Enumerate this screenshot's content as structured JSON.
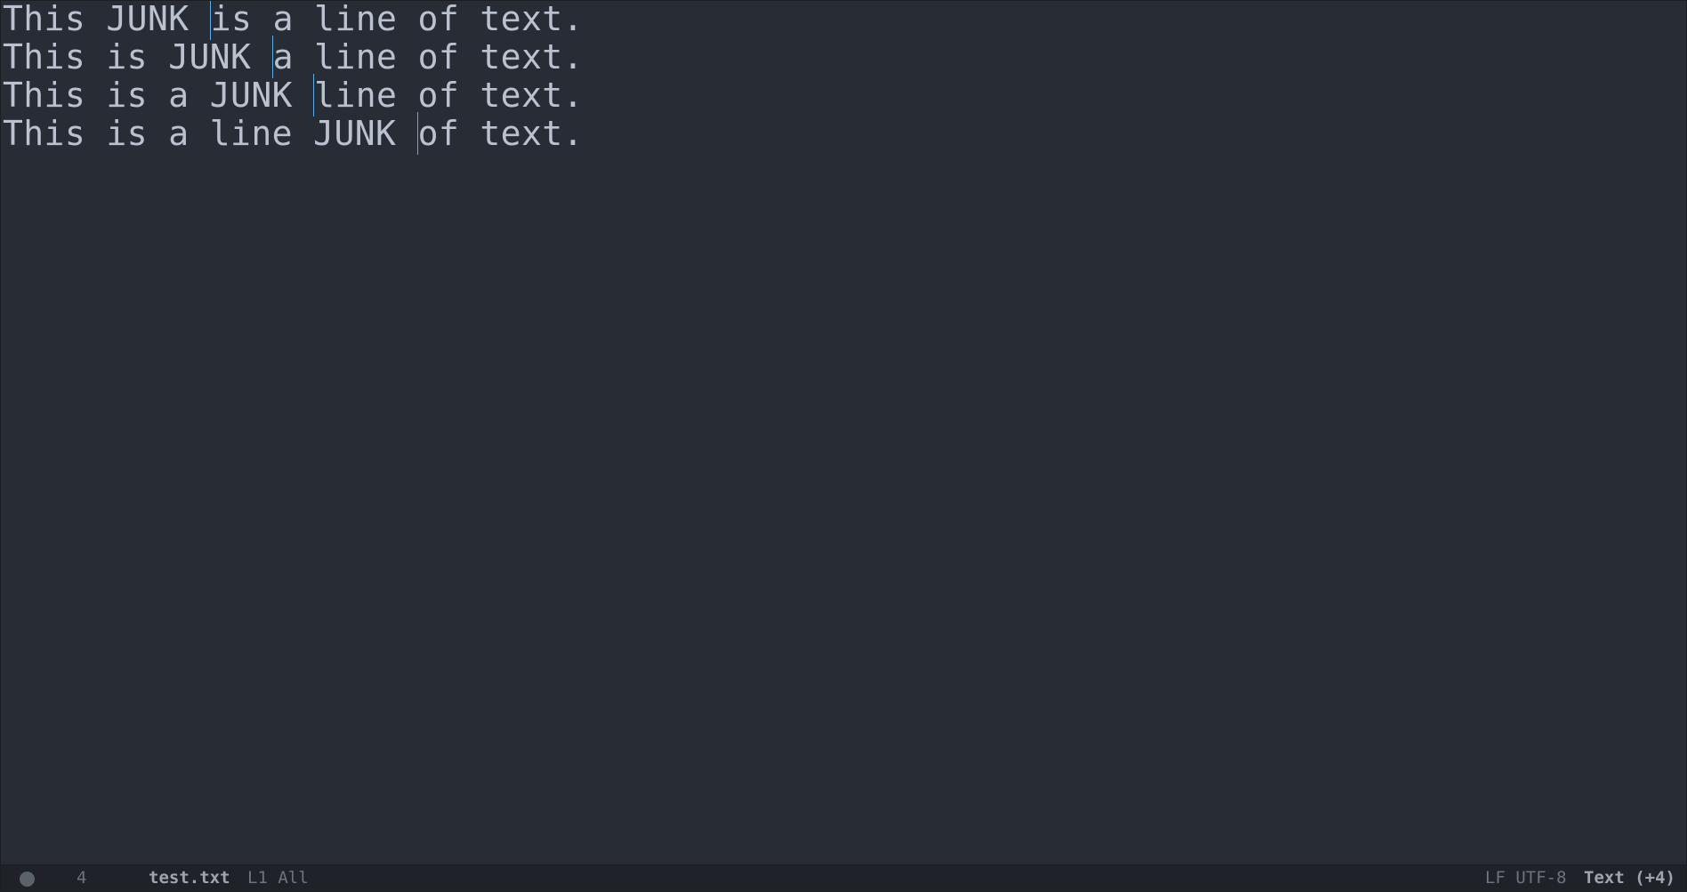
{
  "editor": {
    "lines": [
      {
        "before": "This JUNK ",
        "after": "is a line of text."
      },
      {
        "before": "This is JUNK ",
        "after": "a line of text."
      },
      {
        "before": "This is a JUNK ",
        "after": "line of text."
      },
      {
        "before": "This is a line JUNK ",
        "after": "of text."
      }
    ]
  },
  "modeline": {
    "cursor_count": "4",
    "file_name": "test.txt",
    "position": "L1 All",
    "encoding": "LF UTF-8",
    "mode": "Text (+4)"
  },
  "icons": {
    "status": "record-dot-icon",
    "cursors": "text-cursor-icon",
    "file": "file-icon",
    "edit": "edit-icon"
  },
  "colors": {
    "background": "#282c34",
    "text": "#bbc2cf",
    "cursor": "#51afef",
    "modeline_bg": "#1f2228",
    "modeline_text": "#6c737f"
  }
}
